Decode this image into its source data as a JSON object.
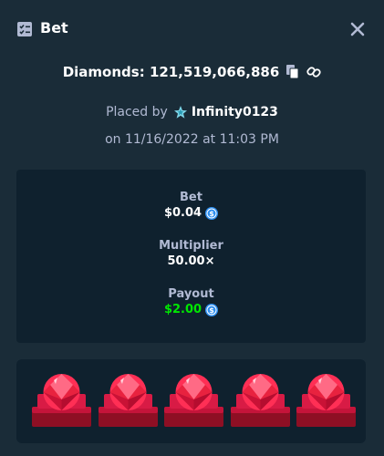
{
  "header": {
    "title": "Bet",
    "icon": "bet-list-icon",
    "close_icon": "close-icon"
  },
  "game": {
    "name_label": "Diamonds:",
    "bet_id": "121,519,066,886",
    "copy_icon": "copy-icon",
    "link_icon": "link-icon"
  },
  "placed": {
    "prefix": "Placed by",
    "player": "Infinity0123",
    "rank_icon": "star-icon",
    "date": "on 11/16/2022 at 11:03 PM"
  },
  "stats": {
    "bet_label": "Bet",
    "bet_value": "$0.04",
    "multiplier_label": "Multiplier",
    "multiplier_value": "50.00×",
    "payout_label": "Payout",
    "payout_value": "$2.00",
    "currency_icon": "usd-coin-icon"
  },
  "gems": {
    "items": [
      "red-diamond",
      "red-diamond",
      "red-diamond",
      "red-diamond",
      "red-diamond"
    ],
    "gem_color": "#ff2f55"
  },
  "colors": {
    "background": "#1a2c38",
    "panel": "#0f212e",
    "muted_text": "#b1bad3",
    "win_green": "#00e701",
    "coin_blue": "#2e8ff0"
  }
}
